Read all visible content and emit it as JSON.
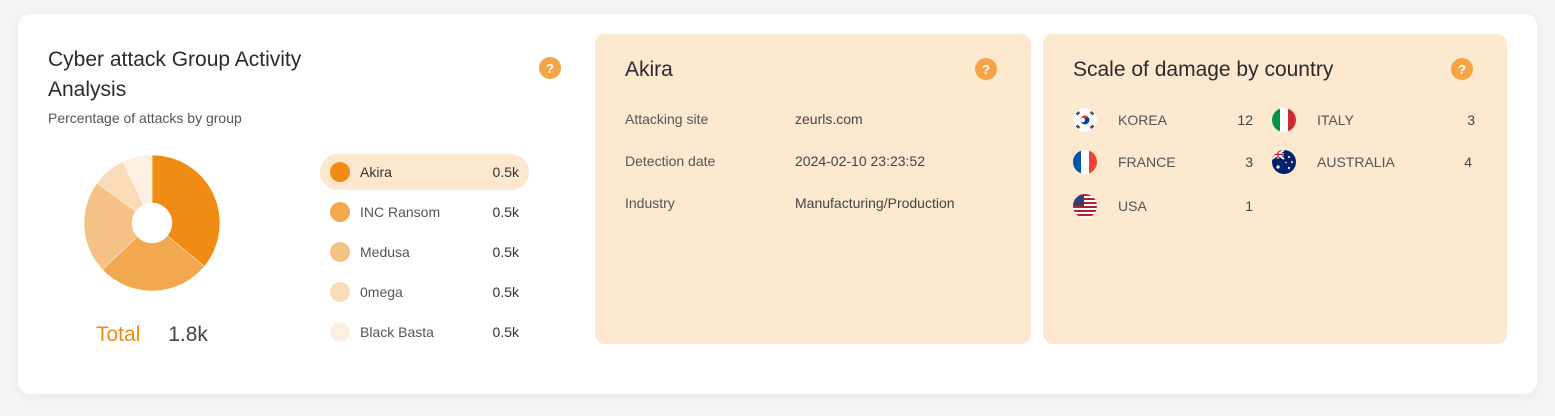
{
  "widget": {
    "title": "Cyber attack Group Activity Analysis",
    "subtitle": "Percentage of attacks by group",
    "help_label": "?",
    "total_label": "Total",
    "total_value": "1.8k"
  },
  "chart_data": {
    "type": "pie",
    "categories": [
      "Akira",
      "INC Ransom",
      "Medusa",
      "0mega",
      "Black Basta"
    ],
    "values": [
      36,
      27,
      22,
      8,
      7
    ],
    "colors": [
      "#f08c14",
      "#f2a84e",
      "#f5c286",
      "#f9dbb8",
      "#fdefe2"
    ]
  },
  "legend": [
    {
      "name": "Akira",
      "value": "0.5k",
      "color": "#f08c14",
      "active": true
    },
    {
      "name": "INC Ransom",
      "value": "0.5k",
      "color": "#f2a84e",
      "active": false
    },
    {
      "name": "Medusa",
      "value": "0.5k",
      "color": "#f5c286",
      "active": false
    },
    {
      "name": "0mega",
      "value": "0.5k",
      "color": "#f9dbb8",
      "active": false
    },
    {
      "name": "Black Basta",
      "value": "0.5k",
      "color": "#fdefe2",
      "active": false
    }
  ],
  "detail": {
    "title": "Akira",
    "rows": [
      {
        "key": "Attacking site",
        "value": "zeurls.com"
      },
      {
        "key": "Detection date",
        "value": "2024-02-10 23:23:52"
      },
      {
        "key": "Industry",
        "value": "Manufacturing/Production"
      }
    ]
  },
  "damage": {
    "title": "Scale of damage by country",
    "countries": [
      {
        "name": "KOREA",
        "count": "12",
        "flag": "korea-flag-icon"
      },
      {
        "name": "ITALY",
        "count": "3",
        "flag": "italy-flag-icon"
      },
      {
        "name": "FRANCE",
        "count": "3",
        "flag": "france-flag-icon"
      },
      {
        "name": "AUSTRALIA",
        "count": "4",
        "flag": "australia-flag-icon"
      },
      {
        "name": "USA",
        "count": "1",
        "flag": "usa-flag-icon"
      }
    ]
  },
  "colors": {
    "accent": "#f08c14",
    "help": "#f5a545",
    "panel": "#fde8d0"
  }
}
